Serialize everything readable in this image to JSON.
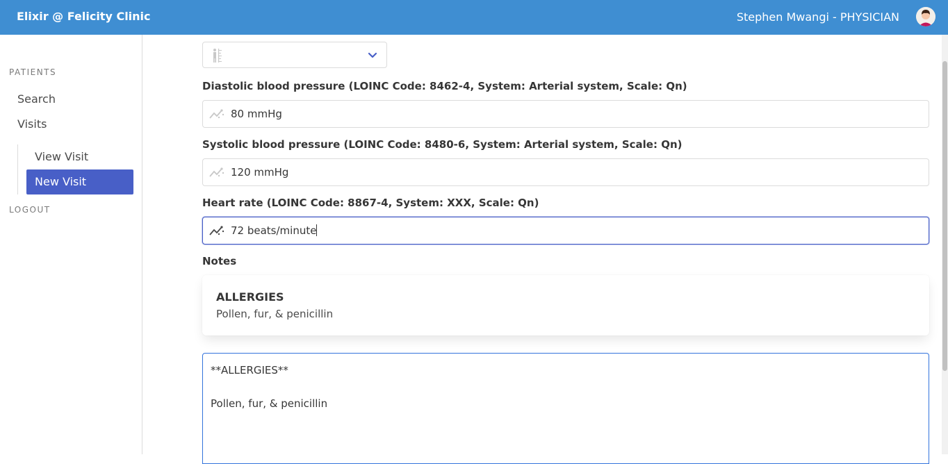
{
  "header": {
    "brand": "Elixir @ Felicity Clinic",
    "user": "Stephen Mwangi - PHYSICIAN"
  },
  "sidebar": {
    "patients_label": "PATIENTS",
    "search": "Search",
    "visits": "Visits",
    "view_visit": "View Visit",
    "new_visit": "New Visit",
    "logout": "LOGOUT"
  },
  "form": {
    "diastolic": {
      "label": "Diastolic blood pressure (LOINC Code: 8462-4, System: Arterial system, Scale: Qn)",
      "value": "80 mmHg"
    },
    "systolic": {
      "label": "Systolic blood pressure (LOINC Code: 8480-6, System: Arterial system, Scale: Qn)",
      "value": "120 mmHg"
    },
    "heart_rate": {
      "label": "Heart rate (LOINC Code: 8867-4, System: XXX, Scale: Qn)",
      "value": "72 beats/minute"
    },
    "notes_label": "Notes",
    "notes_preview": {
      "heading": "ALLERGIES",
      "body": "Pollen, fur, & penicillin"
    },
    "notes_editor": {
      "line1": "**ALLERGIES**",
      "line2": "Pollen, fur, & penicillin"
    }
  },
  "icons": {
    "select_icon": "height-ruler-icon",
    "input_icon": "chart-line-icon",
    "chevron": "chevron-down-icon"
  },
  "colors": {
    "navbar": "#3f8ed2",
    "active_item": "#485fc7",
    "focus_border": "#485fc7"
  }
}
